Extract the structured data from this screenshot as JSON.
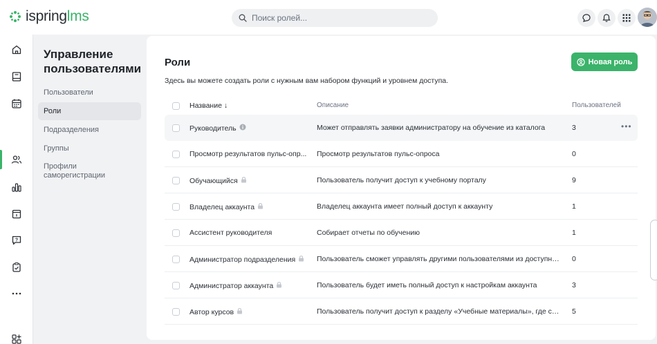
{
  "app": {
    "logo_main": "ispring",
    "logo_suffix": "lms"
  },
  "search": {
    "placeholder": "Поиск ролей...",
    "value": ""
  },
  "header_icons": [
    "chat-icon",
    "bell-icon",
    "apps-grid-icon"
  ],
  "rail": [
    "home-icon",
    "catalog-icon",
    "calendar-icon",
    "users-icon",
    "reports-icon",
    "tasks-icon",
    "feedback-icon",
    "assessment-icon",
    "more-icon",
    "add-widgets-icon"
  ],
  "subnav": {
    "title": "Управление пользователями",
    "items": [
      {
        "label": "Пользователи"
      },
      {
        "label": "Роли"
      },
      {
        "label": "Подразделения"
      },
      {
        "label": "Группы"
      },
      {
        "label": "Профили саморегистрации"
      }
    ]
  },
  "page": {
    "title": "Роли",
    "description": "Здесь вы можете создать роли с нужным вам набором функций и уровнем доступа.",
    "new_role_label": "Новая роль"
  },
  "table": {
    "columns": {
      "name": "Название",
      "name_sort": "↓",
      "description": "Описание",
      "users": "Пользователей"
    },
    "rows": [
      {
        "name": "Руководитель",
        "badge": "info",
        "description": "Может отправлять заявки администратору на обучение из каталога",
        "users": "3"
      },
      {
        "name": "Просмотр результатов пульс-опр...",
        "badge": "",
        "description": "Просмотр результатов пульс-опроса",
        "users": "0"
      },
      {
        "name": "Обучающийся",
        "badge": "lock",
        "description": "Пользователь получит доступ к учебному порталу",
        "users": "9"
      },
      {
        "name": "Владелец аккаунта",
        "badge": "lock",
        "description": "Владелец аккаунта имеет полный доступ к аккаунту",
        "users": "1"
      },
      {
        "name": "Ассистент руководителя",
        "badge": "",
        "description": "Собирает отчеты по обучению",
        "users": "1"
      },
      {
        "name": "Администратор подразделения",
        "badge": "lock",
        "description": "Пользователь сможет управлять другими пользователями из доступны...",
        "users": "0"
      },
      {
        "name": "Администратор аккаунта",
        "badge": "lock",
        "description": "Пользователь будет иметь полный доступ к настройкам аккаунта",
        "users": "3"
      },
      {
        "name": "Автор курсов",
        "badge": "lock",
        "description": "Пользователь получит доступ к разделу «Учебные материалы», где смо...",
        "users": "5"
      }
    ]
  },
  "colors": {
    "accent": "#3bb36a",
    "background": "#f1f2f4",
    "hover_row": "#f5f6f8"
  }
}
